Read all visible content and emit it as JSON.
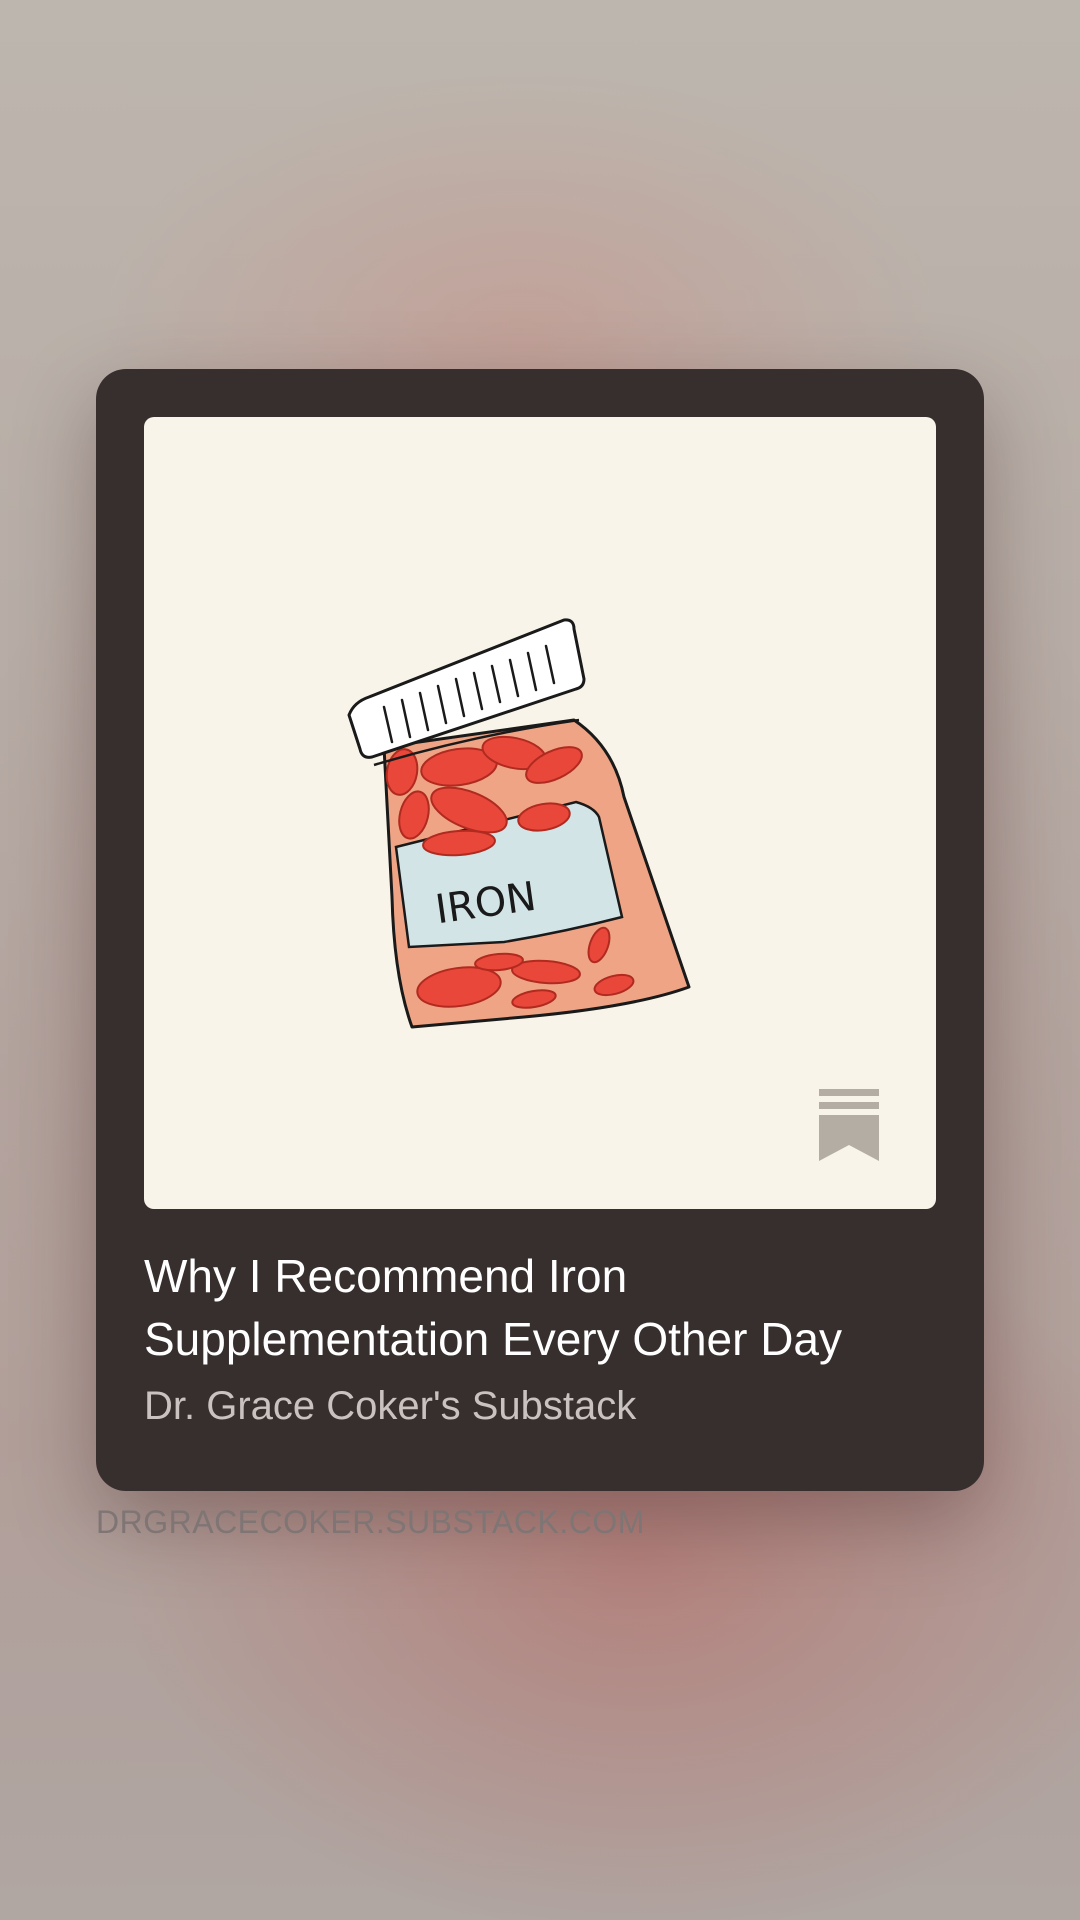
{
  "card": {
    "image_alt": "hand-drawn iron supplement bottle illustration",
    "jar_label": "IRON",
    "bookmark_icon": "substack-bookmark-icon",
    "title": "Why I Recommend Iron Supplementation Every Other Day",
    "publication": "Dr. Grace Coker's Substack"
  },
  "link": {
    "domain": "DRGRACECOKER.SUBSTACK.COM"
  },
  "colors": {
    "card_background": "#372f2e",
    "image_background": "#f8f4e9",
    "pill_red": "#e8473a",
    "bottle_orange": "#efa585",
    "label_blue": "#d3e4e6",
    "bookmark_gray": "#b3ada3"
  }
}
